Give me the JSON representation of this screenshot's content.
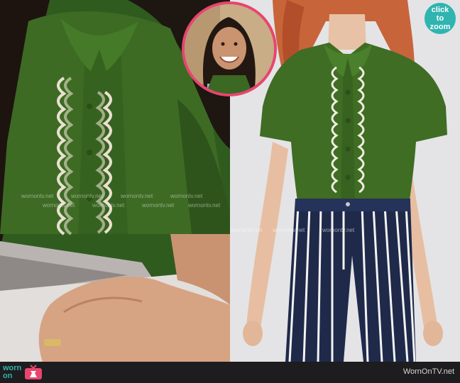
{
  "badge": {
    "label": "click to zoom",
    "color": "#2fb4b0"
  },
  "inset": {
    "border_color": "#e8456f"
  },
  "footer": {
    "logo_word_1": "worn",
    "logo_word_2": "on",
    "logo_icon": "tv-icon",
    "site_url": "WornOnTV.net"
  },
  "watermark_text": "wornontv.net",
  "colors": {
    "shirt_green": "#3c6b22",
    "trouser_navy": "#1f2a4a",
    "accent_teal": "#2fb4b0",
    "inset_pink": "#e8456f"
  }
}
